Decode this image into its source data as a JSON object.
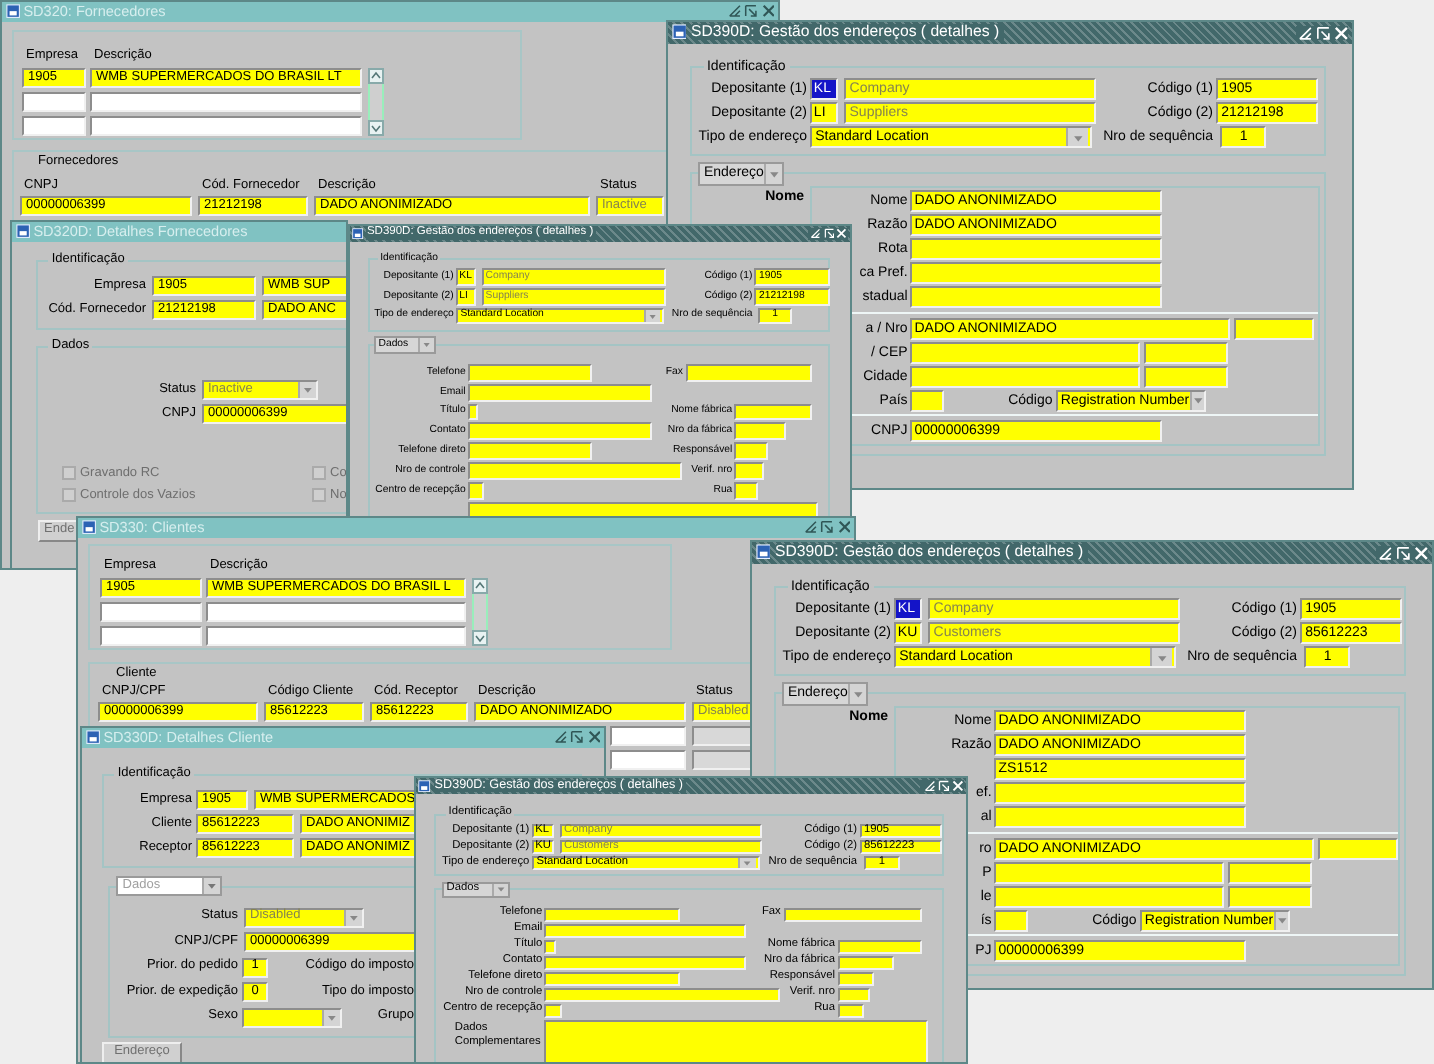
{
  "windows": [
    {
      "kind": "list",
      "title": "SD320: Fornecedores",
      "active": false,
      "company_columns": [
        "Empresa",
        "Descrição"
      ],
      "company_row": [
        "1905",
        "WMB SUPERMERCADOS DO BRASIL LT"
      ],
      "section": "Fornecedores",
      "columns": [
        "CNPJ",
        "Cód. Fornecedor",
        "Descrição",
        "Status"
      ],
      "rows": [
        [
          {
            "value": "00000006399",
            "disabled": false
          },
          {
            "value": "21212198",
            "disabled": false
          },
          {
            "value": "DADO ANONIMIZADO",
            "disabled": false
          },
          {
            "value": "Inactive",
            "disabled": true
          }
        ]
      ]
    },
    {
      "kind": "address",
      "title": "SD390D: Gestão dos endereços ( detalhes )",
      "active": true,
      "ident_caption": "Identificação",
      "depositors": [
        {
          "label": "Depositante (1)",
          "code": "KL",
          "selected": true,
          "name": "Company",
          "name_disabled": true,
          "code_label": "Código (1)",
          "code_value": "1905"
        },
        {
          "label": "Depositante (2)",
          "code": "LI",
          "selected": false,
          "name": "Suppliers",
          "name_disabled": true,
          "code_label": "Código (2)",
          "code_value": "21212198"
        }
      ],
      "type_label": "Tipo de endereço",
      "type_value": "Standard Location",
      "sequence_label": "Nro de sequência",
      "sequence_value": "1",
      "tab": {
        "label": "Endereço",
        "kind": "address"
      },
      "heading": "Nome",
      "address_groups": [
        [
          {
            "kind": "single",
            "label": "Nome",
            "value": "DADO ANONIMIZADO"
          },
          {
            "kind": "single",
            "label": "Razão",
            "value": "DADO ANONIMIZADO"
          },
          {
            "kind": "single",
            "label": "Rota"
          },
          {
            "kind": "single",
            "label": "ca Pref."
          },
          {
            "kind": "single",
            "label": "stadual"
          }
        ],
        [
          {
            "kind": "pair",
            "label": "a / Nro",
            "value": "DADO ANONIMIZADO"
          },
          {
            "kind": "pair",
            "label": "/ CEP"
          },
          {
            "kind": "pair",
            "label": "Cidade"
          },
          {
            "kind": "country",
            "label": "País",
            "code_label": "Código",
            "code_value": "Registration Number"
          }
        ],
        [
          {
            "kind": "single",
            "label": "CNPJ",
            "value": "00000006399"
          }
        ]
      ]
    },
    {
      "kind": "detail",
      "title": "SD320D: Detalhes Fornecedores",
      "active": false,
      "ident_caption": "Identificação",
      "ident_rows": [
        {
          "label": "Empresa",
          "code": "1905",
          "name": "WMB SUP"
        },
        {
          "label": "Cód. Fornecedor",
          "code": "21212198",
          "name": "DADO ANC"
        }
      ],
      "data_caption": "Dados",
      "fields": [
        {
          "kind": "dropdown",
          "label": "Status",
          "value": "Inactive",
          "disabled": true
        },
        {
          "kind": "text",
          "label": "CNPJ",
          "value": "00000006399",
          "disabled": false
        }
      ],
      "checkboxes": [
        {
          "label": "Gravando RC",
          "checked": false,
          "disabled": true
        },
        {
          "label": "Co",
          "checked": false,
          "disabled": true
        },
        {
          "label": "Controle dos Vazios",
          "checked": false,
          "disabled": true
        },
        {
          "label": "No",
          "checked": false,
          "disabled": true
        }
      ],
      "button": {
        "label": "Ende",
        "disabled": true
      }
    },
    {
      "kind": "address",
      "title": "SD390D: Gestão dos endereços ( detalhes )",
      "active": true,
      "ident_caption": "Identificação",
      "depositors": [
        {
          "label": "Depositante (1)",
          "code": "KL",
          "selected": false,
          "name": "Company",
          "name_disabled": true,
          "code_label": "Código (1)",
          "code_value": "1905"
        },
        {
          "label": "Depositante (2)",
          "code": "LI",
          "selected": false,
          "name": "Suppliers",
          "name_disabled": true,
          "code_label": "Código (2)",
          "code_value": "21212198"
        }
      ],
      "type_label": "Tipo de endereço",
      "type_value": "Standard Location",
      "sequence_label": "Nro de sequência",
      "sequence_value": "1",
      "tab": {
        "label": "Dados",
        "kind": "data"
      },
      "data_rows": [
        {
          "label": "Telefone",
          "right_label": "Fax"
        },
        {
          "label": "Email"
        },
        {
          "label": "Título",
          "right_label": "Nome fábrica"
        },
        {
          "label": "Contato",
          "right_label": "Nro da fábrica"
        },
        {
          "label": "Telefone direto",
          "right_label": "Responsável"
        },
        {
          "label": "Nro de controle",
          "right_label": "Verif. nro"
        },
        {
          "label": "Centro de recepção",
          "right_label": "Rua"
        }
      ]
    },
    {
      "kind": "list",
      "title": "SD330: Clientes",
      "active": false,
      "company_columns": [
        "Empresa",
        "Descrição"
      ],
      "company_row": [
        "1905",
        "WMB SUPERMERCADOS DO BRASIL L"
      ],
      "section": "Cliente",
      "columns": [
        "CNPJ/CPF",
        "Código Cliente",
        "Cód. Receptor",
        "Descrição",
        "Status"
      ],
      "rows": [
        [
          {
            "value": "00000006399",
            "disabled": false
          },
          {
            "value": "85612223",
            "disabled": false
          },
          {
            "value": "85612223",
            "disabled": false
          },
          {
            "value": "DADO ANONIMIZADO",
            "disabled": false
          },
          {
            "value": "Disabled",
            "disabled": true
          }
        ]
      ]
    },
    {
      "kind": "address",
      "title": "SD390D: Gestão dos endereços ( detalhes )",
      "active": true,
      "ident_caption": "Identificação",
      "depositors": [
        {
          "label": "Depositante (1)",
          "code": "KL",
          "selected": true,
          "name": "Company",
          "name_disabled": true,
          "code_label": "Código (1)",
          "code_value": "1905"
        },
        {
          "label": "Depositante (2)",
          "code": "KU",
          "selected": false,
          "name": "Customers",
          "name_disabled": true,
          "code_label": "Código (2)",
          "code_value": "85612223"
        }
      ],
      "type_label": "Tipo de endereço",
      "type_value": "Standard Location",
      "sequence_label": "Nro de sequência",
      "sequence_value": "1",
      "tab": {
        "label": "Endereço",
        "kind": "address"
      },
      "heading": "Nome",
      "address_groups": [
        [
          {
            "kind": "single",
            "label": "Nome",
            "value": "DADO ANONIMIZADO"
          },
          {
            "kind": "single",
            "label": "Razão",
            "value": "DADO ANONIMIZADO"
          },
          {
            "kind": "single",
            "value": "ZS1512"
          },
          {
            "kind": "single",
            "label": "ef."
          },
          {
            "kind": "single",
            "label": "al"
          }
        ],
        [
          {
            "kind": "pair",
            "label": "ro",
            "value": "DADO ANONIMIZADO"
          },
          {
            "kind": "pair",
            "label": "P"
          },
          {
            "kind": "pair",
            "label": "le"
          },
          {
            "kind": "country",
            "label": "ís",
            "code_label": "Código",
            "code_value": "Registration Number"
          }
        ],
        [
          {
            "kind": "single",
            "label": "PJ",
            "value": "00000006399"
          }
        ]
      ]
    },
    {
      "kind": "detail",
      "title": "SD330D: Detalhes Cliente",
      "active": false,
      "ident_caption": "Identificação",
      "ident_rows": [
        {
          "label": "Empresa",
          "code": "1905",
          "name": "WMB SUPERMERCADOS"
        },
        {
          "label": "Cliente",
          "code": "85612223",
          "name": "DADO ANONIMIZ"
        },
        {
          "label": "Receptor",
          "code": "85612223",
          "name": "DADO ANONIMIZ"
        }
      ],
      "data_tab": {
        "label": "Dados",
        "disabled": true
      },
      "fields": [
        {
          "kind": "dropdown",
          "label": "Status",
          "value": "Disabled",
          "disabled": true
        },
        {
          "kind": "text",
          "label": "CNPJ/CPF",
          "value": "00000006399",
          "disabled": false
        }
      ],
      "pairs": [
        {
          "kind": "text",
          "label": "Prior. do pedido",
          "value": "1",
          "right_label": "Código do imposto"
        },
        {
          "kind": "text",
          "label": "Prior. de expedição",
          "value": "0",
          "right_label": "Tipo do imposto"
        },
        {
          "kind": "dropdown",
          "label": "Sexo",
          "right_label": "Grupo"
        }
      ],
      "button": {
        "label": "Endereço",
        "disabled": true
      }
    },
    {
      "kind": "address",
      "title": "SD390D: Gestão dos endereços ( detalhes )",
      "active": true,
      "ident_caption": "Identificação",
      "depositors": [
        {
          "label": "Depositante (1)",
          "code": "KL",
          "selected": false,
          "name": "Company",
          "name_disabled": true,
          "code_label": "Código (1)",
          "code_value": "1905"
        },
        {
          "label": "Depositante (2)",
          "code": "KU",
          "selected": false,
          "name": "Customers",
          "name_disabled": true,
          "code_label": "Código (2)",
          "code_value": "85612223"
        }
      ],
      "type_label": "Tipo de endereço",
      "type_value": "Standard Location",
      "sequence_label": "Nro de sequência",
      "sequence_value": "1",
      "tab": {
        "label": "Dados",
        "kind": "data"
      },
      "data_rows": [
        {
          "label": "Telefone",
          "right_label": "Fax"
        },
        {
          "label": "Email"
        },
        {
          "label": "Título",
          "right_label": "Nome fábrica"
        },
        {
          "label": "Contato",
          "right_label": "Nro da fábrica"
        },
        {
          "label": "Telefone direto",
          "right_label": "Responsável"
        },
        {
          "label": "Nro de controle",
          "right_label": "Verif. nro"
        },
        {
          "label": "Centro de recepção",
          "right_label": "Rua"
        }
      ],
      "complement_label": "Dados Complementares"
    }
  ]
}
